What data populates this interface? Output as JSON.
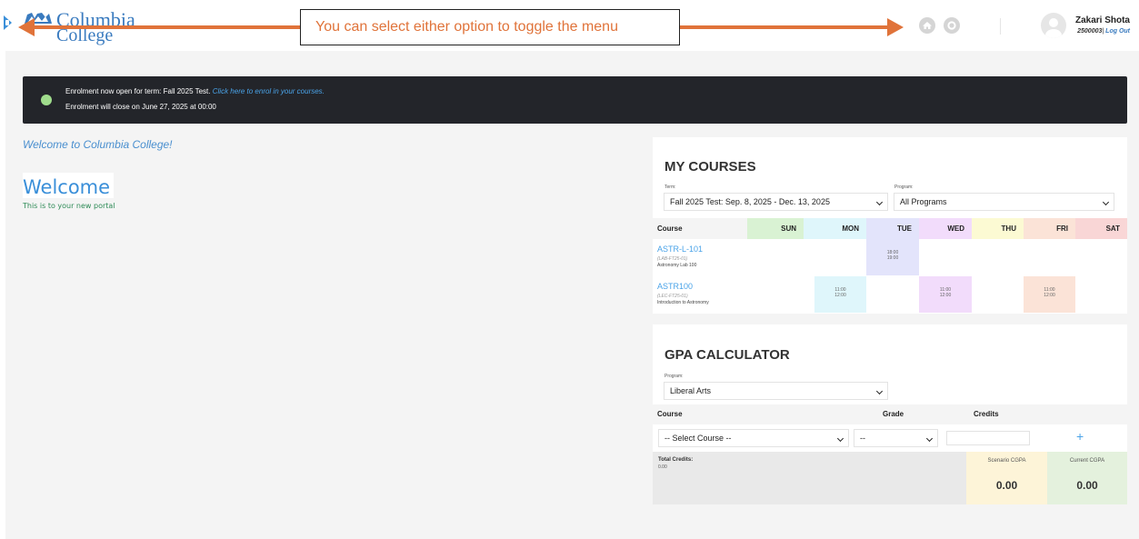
{
  "brand": {
    "line1": "Columbia",
    "line2": "College"
  },
  "annotation": {
    "text": "You can select either option to toggle the menu"
  },
  "user": {
    "name": "Zakari Shota",
    "id": "2500003",
    "separator": "|",
    "logout": "Log Out"
  },
  "icons": {
    "menu_toggle": "chevron-right-icon",
    "home": "home-icon",
    "settings": "gear-icon",
    "user": "user-avatar-icon"
  },
  "enrolment": {
    "line1_prefix": "Enrolment now open for term: Fall 2025 Test.",
    "line1_link": "Click here to enrol in your courses.",
    "line2": "Enrolment will close on June 27, 2025 at 00:00"
  },
  "welcome": {
    "heading": "Welcome to Columbia College!",
    "big": "Welcome",
    "sub": "This is to your new portal"
  },
  "my_courses": {
    "title": "MY COURSES",
    "term_label": "Term:",
    "term_value": "Fall 2025 Test: Sep. 8, 2025 - Dec. 13, 2025",
    "program_label": "Program:",
    "program_value": "All Programs",
    "columns": {
      "course": "Course",
      "sun": "SUN",
      "mon": "MON",
      "tue": "TUE",
      "wed": "WED",
      "thu": "THU",
      "fri": "FRI",
      "sat": "SAT"
    },
    "rows": [
      {
        "code": "ASTR-L-101",
        "section": "(LAB-FT25-01)",
        "title": "Astronomy Lab 100",
        "tue_start": "18:00",
        "tue_end": "19:00"
      },
      {
        "code": "ASTR100",
        "section": "(LEC-FT25-01)",
        "title": "Introduction to Astronomy",
        "mon_start": "11:00",
        "mon_end": "12:00",
        "wed_start": "11:00",
        "wed_end": "12:00",
        "fri_start": "11:00",
        "fri_end": "12:00"
      }
    ]
  },
  "gpa": {
    "title": "GPA CALCULATOR",
    "program_label": "Program:",
    "program_value": "Liberal Arts",
    "col_course": "Course",
    "col_grade": "Grade",
    "col_credits": "Credits",
    "course_placeholder": "-- Select Course --",
    "grade_placeholder": "--",
    "add_label": "+",
    "total_credits_label": "Total Credits:",
    "total_credits_value": "0.00",
    "scenario_label": "Scenario CGPA",
    "scenario_value": "0.00",
    "current_label": "Current CGPA",
    "current_value": "0.00"
  },
  "colors": {
    "accent": "#3a8fd9",
    "annotation": "#e0733a",
    "banner_bg": "#23252a",
    "status_dot": "#9fdc8c",
    "sun": "#d9f2d3",
    "mon": "#dff6fb",
    "tue": "#e3e4fb",
    "wed": "#f2dcfb",
    "thu": "#fcfad3",
    "fri": "#fbe3d7",
    "sat": "#f9d6d6"
  }
}
